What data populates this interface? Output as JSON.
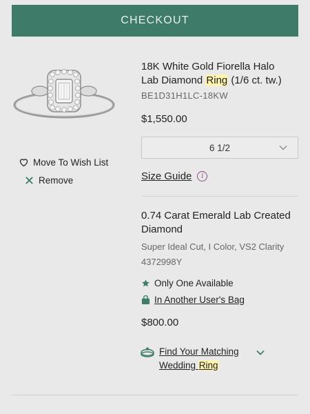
{
  "checkout": {
    "label": "CHECKOUT"
  },
  "item1": {
    "title_line1": "18K White Gold Fiorella Halo",
    "title_line2_pre": "Lab Diamond ",
    "title_highlight": "Ring",
    "title_line2_post": " (1/6 ct. tw.)",
    "sku": "BE1D31H1LC-18KW",
    "price": "$1,550.00",
    "size_value": "6 1/2",
    "size_guide": "Size Guide",
    "wishlist": "Move To Wish List",
    "remove": "Remove"
  },
  "item2": {
    "title": "0.74 Carat Emerald Lab Created Diamond",
    "desc_line1": "Super Ideal Cut, I Color, VS2 Clarity",
    "desc_line2": "4372998Y",
    "availability": "Only One Available",
    "bag_text": "In Another User's Bag",
    "price": "$800.00",
    "match_line1": "Find Your Matching",
    "match_line2_pre": "Wedding ",
    "match_highlight": "Ring"
  },
  "colors": {
    "accent": "#3f7b69",
    "highlight": "#fff3b0",
    "info": "#8a4c8a"
  }
}
